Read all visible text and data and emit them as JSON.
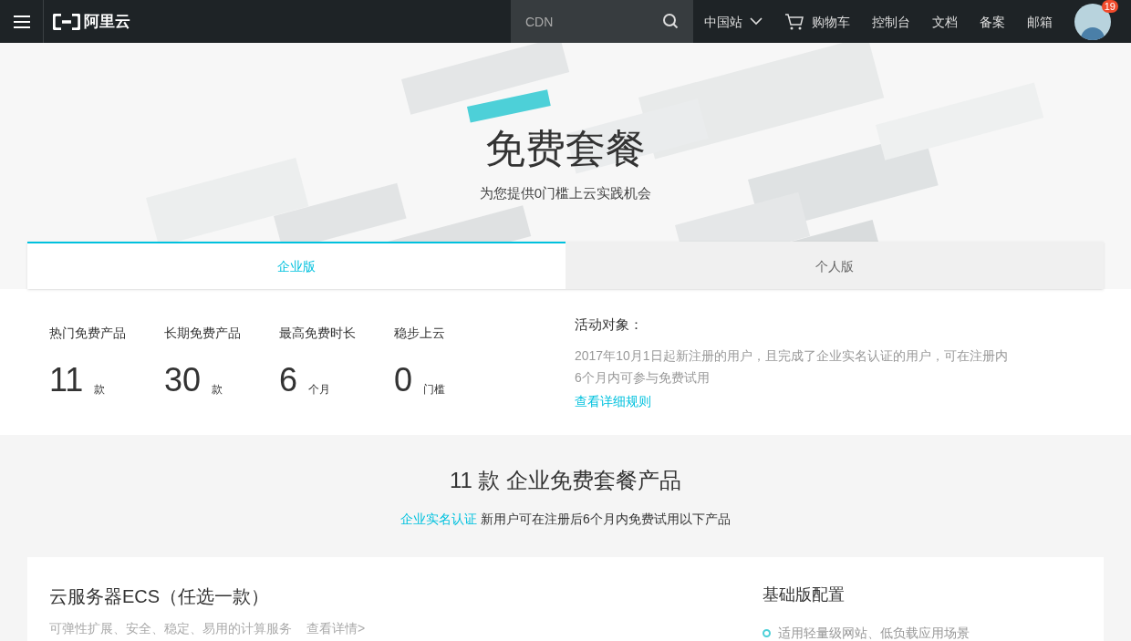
{
  "nav": {
    "logo_text": "阿里云",
    "search": {
      "placeholder": "CDN"
    },
    "region": "中国站",
    "cart": "购物车",
    "links": [
      "控制台",
      "文档",
      "备案",
      "邮箱"
    ],
    "badge": "19"
  },
  "hero": {
    "title": "免费套餐",
    "subtitle": "为您提供0门槛上云实践机会"
  },
  "tabs": [
    {
      "label": "企业版",
      "selected": true
    },
    {
      "label": "个人版",
      "selected": false
    }
  ],
  "stats": [
    {
      "label": "热门免费产品",
      "value": "11",
      "unit": "款"
    },
    {
      "label": "长期免费产品",
      "value": "30",
      "unit": "款"
    },
    {
      "label": "最高免费时长",
      "value": "6",
      "unit": "个月"
    },
    {
      "label": "稳步上云",
      "value": "0",
      "unit": "门槛"
    }
  ],
  "audience": {
    "title": "活动对象：",
    "text": "2017年10月1日起新注册的用户，且完成了企业实名认证的用户，可在注册内6个月内可参与免费试用",
    "link": "查看详细规则"
  },
  "section": {
    "title": "11 款 企业免费套餐产品",
    "link": "企业实名认证",
    "note": "新用户可在注册后6个月内免费试用以下产品"
  },
  "product": {
    "title": "云服务器ECS（任选一款）",
    "desc": "可弹性扩展、安全、稳定、易用的计算服务",
    "more": "查看详情>",
    "config_title": "基础版配置",
    "features": [
      "适用轻量级网站、低负载应用场景"
    ]
  }
}
